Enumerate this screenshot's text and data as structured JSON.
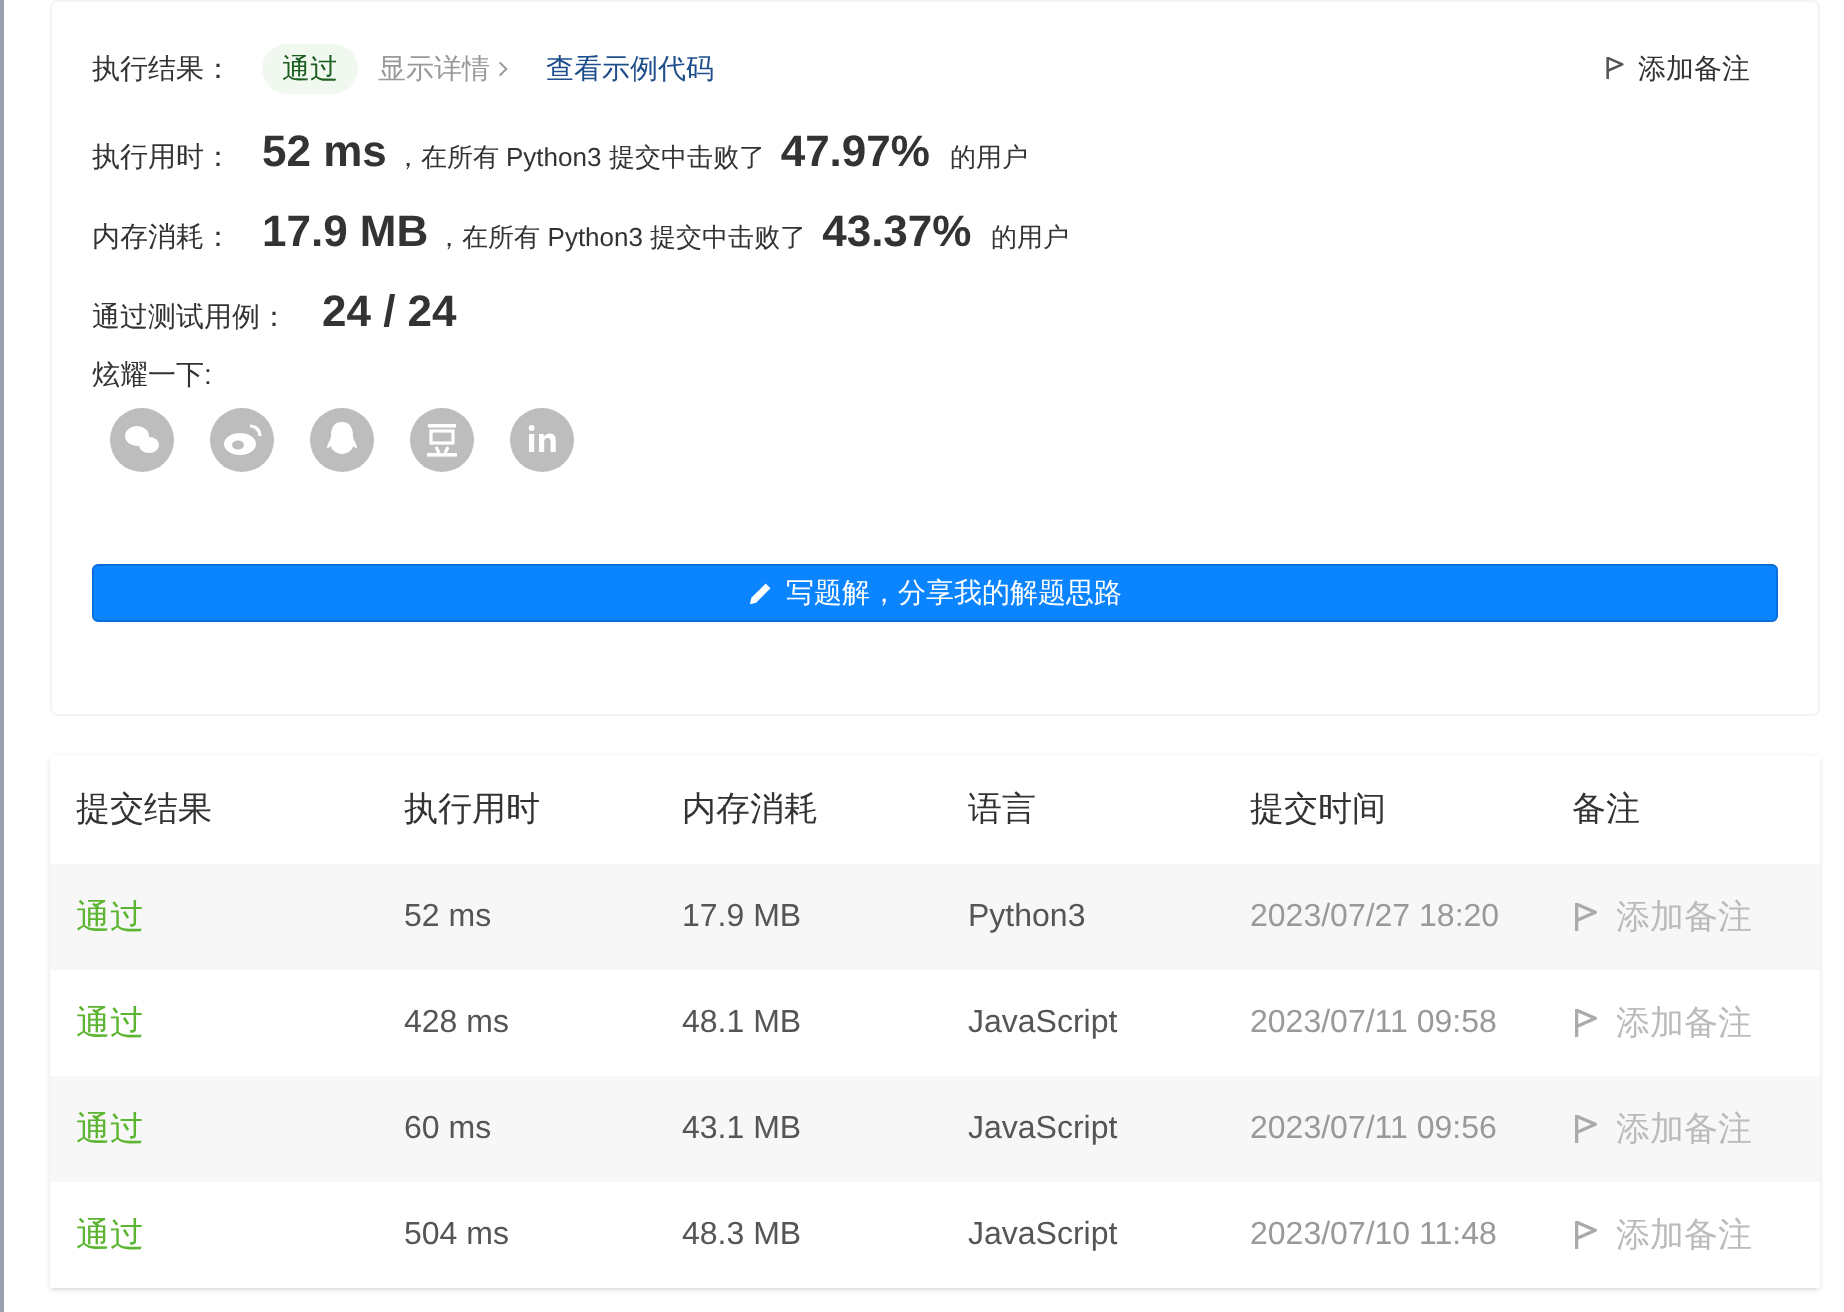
{
  "result": {
    "label": "执行结果：",
    "status": "通过",
    "details_link": "显示详情",
    "sample_code_link": "查看示例代码",
    "note_button": "添加备注"
  },
  "stats": [
    {
      "label": "执行用时：",
      "value": "52 ms",
      "middle": "，在所有 Python3 提交中击败了",
      "percent": "47.97%",
      "suffix": "的用户"
    },
    {
      "label": "内存消耗：",
      "value": "17.9 MB",
      "middle": "，在所有 Python3 提交中击败了",
      "percent": "43.37%",
      "suffix": "的用户"
    }
  ],
  "tests": {
    "label": "通过测试用例：",
    "value": "24 / 24"
  },
  "share": {
    "label": "炫耀一下:",
    "icons": [
      {
        "kind": "wechat"
      },
      {
        "kind": "weibo"
      },
      {
        "kind": "qq"
      },
      {
        "kind": "douban"
      },
      {
        "kind": "linkedin"
      }
    ]
  },
  "write_button": "写题解，分享我的解题思路",
  "table": {
    "columns": [
      "提交结果",
      "执行用时",
      "内存消耗",
      "语言",
      "提交时间",
      "备注"
    ],
    "rows": [
      {
        "status": "通过",
        "runtime": "52 ms",
        "memory": "17.9 MB",
        "language": "Python3",
        "time": "2023/07/27 18:20",
        "note": "添加备注"
      },
      {
        "status": "通过",
        "runtime": "428 ms",
        "memory": "48.1 MB",
        "language": "JavaScript",
        "time": "2023/07/11 09:58",
        "note": "添加备注"
      },
      {
        "status": "通过",
        "runtime": "60 ms",
        "memory": "43.1 MB",
        "language": "JavaScript",
        "time": "2023/07/11 09:56",
        "note": "添加备注"
      },
      {
        "status": "通过",
        "runtime": "504 ms",
        "memory": "48.3 MB",
        "language": "JavaScript",
        "time": "2023/07/10 11:48",
        "note": "添加备注"
      }
    ]
  }
}
